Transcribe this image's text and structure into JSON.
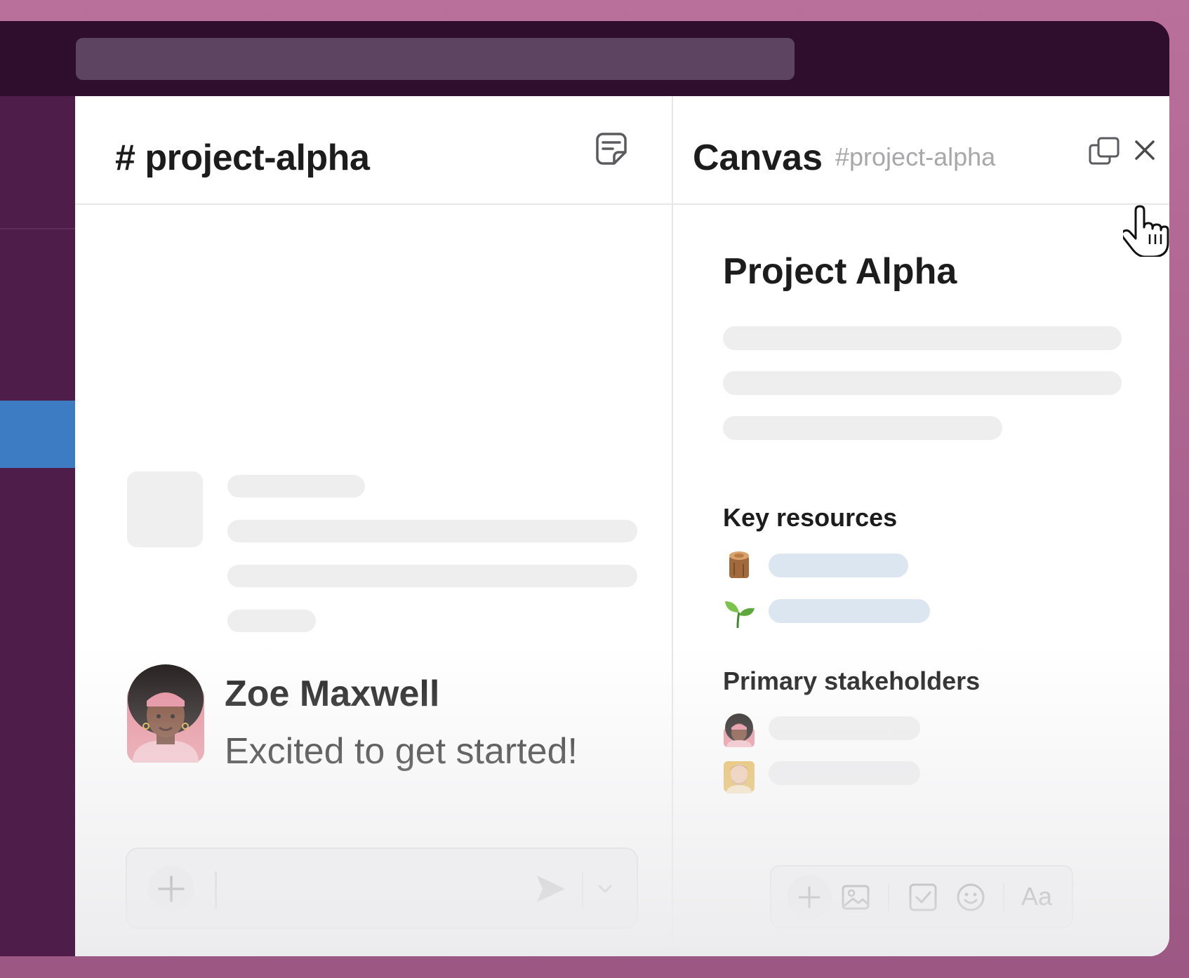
{
  "channel": {
    "title": "# project-alpha"
  },
  "message": {
    "sender": "Zoe Maxwell",
    "text": "Excited to get started!"
  },
  "canvas": {
    "title": "Canvas",
    "channel": "#project-alpha",
    "doc_title": "Project Alpha",
    "key_resources_heading": "Key resources",
    "stakeholders_heading": "Primary stakeholders",
    "text_style_label": "Aa"
  },
  "icons": {
    "notes": "notes-icon",
    "popout": "popout-icon",
    "close": "close-icon",
    "add": "plus-icon",
    "send": "send-icon",
    "chevron": "chevron-down-icon",
    "image": "image-icon",
    "checkbox": "checkbox-icon",
    "emoji": "emoji-icon",
    "log": "log-emoji-icon",
    "seedling": "seedling-emoji-icon",
    "cursor": "hand-cursor-icon"
  },
  "colors": {
    "titlebar": "#2f0d2d",
    "sidebar": "#4f1d4a",
    "active_item": "#3d7bc2",
    "background": "#b9709a"
  }
}
